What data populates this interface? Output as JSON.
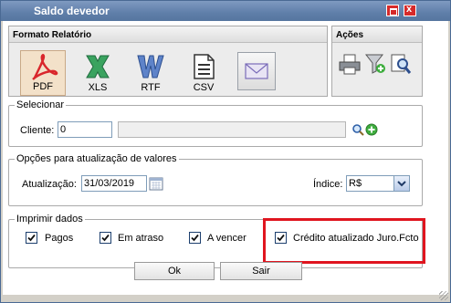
{
  "window": {
    "title": "Saldo devedor"
  },
  "formato": {
    "header": "Formato Relatório",
    "items": [
      {
        "label": "PDF",
        "icon": "pdf-icon",
        "selected": true
      },
      {
        "label": "XLS",
        "icon": "xls-icon"
      },
      {
        "label": "RTF",
        "icon": "rtf-icon"
      },
      {
        "label": "CSV",
        "icon": "csv-icon"
      }
    ],
    "extra_icon": "envelope-icon"
  },
  "acoes": {
    "header": "Ações",
    "icons": [
      "printer-icon",
      "add-filter-icon",
      "preview-icon"
    ]
  },
  "selecionar": {
    "legend": "Selecionar",
    "cliente_label": "Cliente:",
    "cliente_value": "0",
    "cliente_name": "",
    "icons": [
      "search-icon",
      "add-icon"
    ]
  },
  "opcoes": {
    "legend": "Opções para atualização de valores",
    "atualizacao_label": "Atualização:",
    "atualizacao_value": "31/03/2019",
    "indice_label": "Índice:",
    "indice_value": "R$"
  },
  "imprimir": {
    "legend": "Imprimir dados",
    "checks": [
      {
        "label": "Pagos",
        "checked": true
      },
      {
        "label": "Em atraso",
        "checked": true
      },
      {
        "label": "A vencer",
        "checked": true
      },
      {
        "label": "Crédito atualizado Juro.Fcto",
        "checked": true
      }
    ]
  },
  "buttons": {
    "ok": "Ok",
    "sair": "Sair"
  },
  "colors": {
    "titlebar": "#5f7ea9",
    "highlight": "#e0151f",
    "pdf": "#d9262b",
    "xls": "#2e8b57",
    "rtf": "#3a5fa8"
  }
}
